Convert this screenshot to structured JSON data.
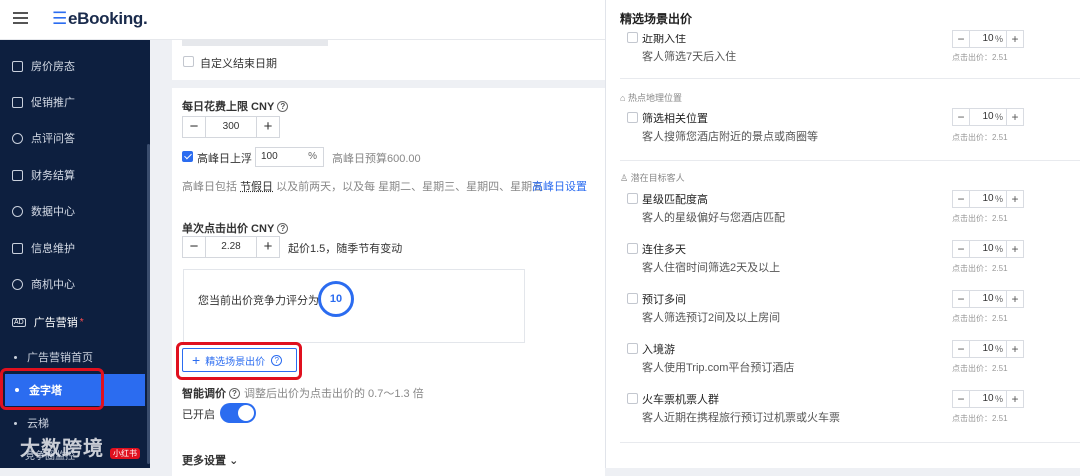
{
  "app": {
    "logo": "eBooking."
  },
  "sidebar": {
    "items": [
      {
        "label": "房价房态",
        "icon": "home-icon"
      },
      {
        "label": "促销推广",
        "icon": "promo-icon"
      },
      {
        "label": "点评问答",
        "icon": "users-icon"
      },
      {
        "label": "财务结算",
        "icon": "finance-icon"
      },
      {
        "label": "数据中心",
        "icon": "chart-icon"
      },
      {
        "label": "信息维护",
        "icon": "edit-icon"
      },
      {
        "label": "商机中心",
        "icon": "opportunity-icon"
      }
    ],
    "ad_section": {
      "badge": "AD",
      "label": "广告营销",
      "star": "*"
    },
    "sub_items": [
      "广告营销首页",
      "金字塔",
      "云梯",
      "竞争圈监控"
    ],
    "active_item": "金字塔"
  },
  "main": {
    "custom_end_date": "自定义结束日期",
    "daily_limit": {
      "label": "每日花费上限 CNY",
      "value": "300"
    },
    "peak": {
      "label": "高峰日上浮",
      "percent": "100",
      "unit": "%",
      "budget": "高峰日预算600.00",
      "desc_prefix": "高峰日包括",
      "holiday": "节假日",
      "desc_suffix": "以及前两天，以及每 星期二、星期三、星期四、星期五",
      "settings_link": "高峰日设置"
    },
    "cpc": {
      "label": "单次点击出价 CNY",
      "value": "2.28",
      "note": "起价1.5，随季节有变动",
      "score_label": "您当前出价竞争力评分为",
      "score": "10"
    },
    "scene_button": "精选场景出价",
    "smart": {
      "label": "智能调价",
      "desc": "调整后出价为点击出价的 0.7～1.3 倍",
      "status": "已开启"
    },
    "more": "更多设置"
  },
  "panel": {
    "title": "精选场景出价",
    "price_text": "点击出价：2.51",
    "pct_unit": "%",
    "top_item": {
      "name": "近期入住",
      "desc": "客人筛选7天后入住",
      "value": "10"
    },
    "groups": [
      {
        "label": "热点地理位置",
        "items": [
          {
            "name": "筛选相关位置",
            "desc": "客人搜筛您酒店附近的景点或商圈等",
            "value": "10"
          }
        ]
      },
      {
        "label": "潜在目标客人",
        "items": [
          {
            "name": "星级匹配度高",
            "desc": "客人的星级偏好与您酒店匹配",
            "value": "10"
          },
          {
            "name": "连住多天",
            "desc": "客人住宿时间筛选2天及以上",
            "value": "10"
          },
          {
            "name": "预订多间",
            "desc": "客人筛选预订2间及以上房间",
            "value": "10"
          },
          {
            "name": "入境游",
            "desc": "客人使用Trip.com平台预订酒店",
            "value": "10"
          },
          {
            "name": "火车票机票人群",
            "desc": "客人近期在携程旅行预订过机票或火车票",
            "value": "10"
          }
        ]
      }
    ]
  },
  "watermark": {
    "text": "大数跨境",
    "sub": "竞争圈监控",
    "badge": "小红书"
  }
}
